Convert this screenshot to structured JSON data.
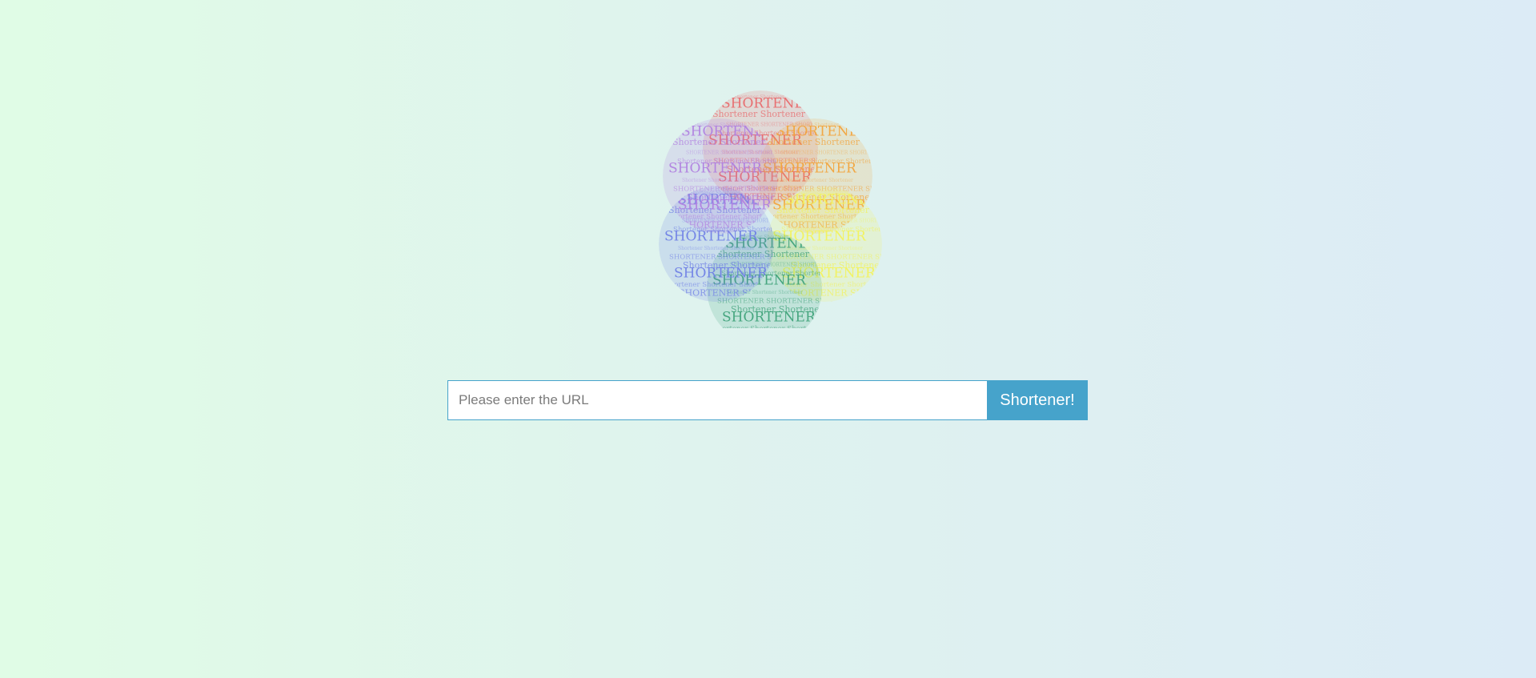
{
  "logo": {
    "word": "Shortener",
    "word_upper": "SHORTENER",
    "petal_colors": [
      "#e8696c",
      "#f2a43c",
      "#f2f25c",
      "#3fa27a",
      "#6f7fe6",
      "#b07fe0"
    ]
  },
  "search": {
    "placeholder": "Please enter the URL",
    "value": "",
    "button_label": "Shortener!"
  },
  "colors": {
    "accent": "#46a3cb",
    "bg_left": "#e0fce6",
    "bg_right": "#dcebf6"
  }
}
